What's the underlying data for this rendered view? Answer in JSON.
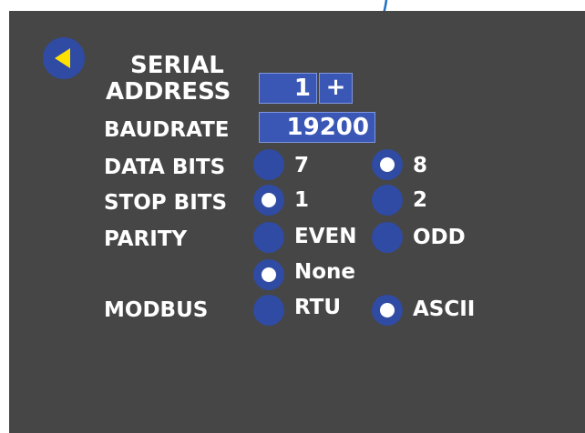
{
  "labels": {
    "serial_line1": "SERIAL",
    "serial_line2": "ADDRESS",
    "baudrate": "BAUDRATE",
    "data_bits": "DATA BITS",
    "stop_bits": "STOP BITS",
    "parity": "PARITY",
    "modbus": "MODBUS"
  },
  "serial_address": {
    "value": "1",
    "increment_label": "+"
  },
  "baudrate": {
    "value": "19200"
  },
  "data_bits": {
    "options": [
      "7",
      "8"
    ],
    "selected": "8"
  },
  "stop_bits": {
    "options": [
      "1",
      "2"
    ],
    "selected": "1"
  },
  "parity": {
    "options": [
      "EVEN",
      "ODD",
      "None"
    ],
    "selected": "None"
  },
  "modbus": {
    "options": [
      "RTU",
      "ASCII"
    ],
    "selected": "ASCII"
  },
  "colors": {
    "panel": "#464646",
    "button": "#2f4ba4",
    "field": "#3a57b5",
    "back_arrow": "#ffe100",
    "annotation_arrow": "#1f6fc1"
  },
  "icons": {
    "back": "back-arrow-icon",
    "annotation": "annotation-arrow"
  }
}
